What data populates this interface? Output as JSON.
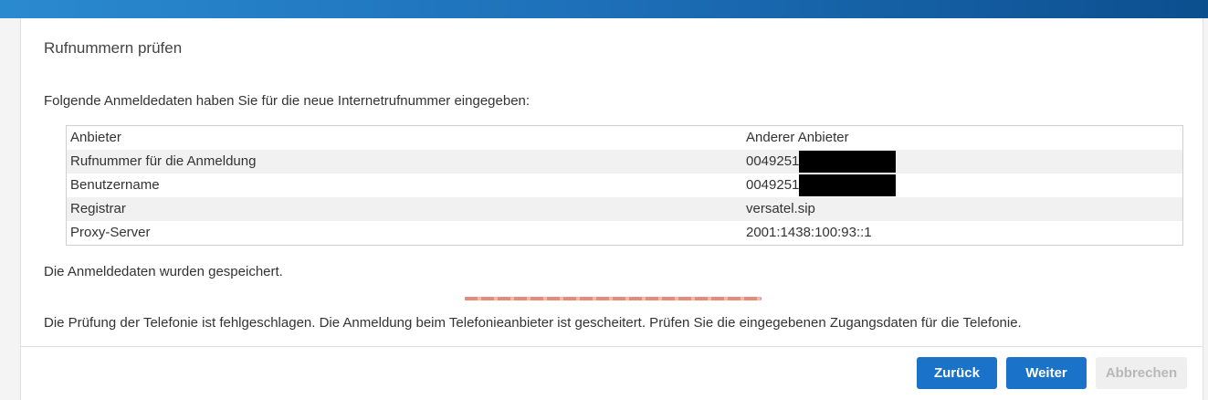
{
  "dialog": {
    "title": "Rufnummern prüfen",
    "intro": "Folgende Anmeldedaten haben Sie für die neue Internetrufnummer eingegeben:",
    "saved_message": "Die Anmeldedaten wurden gespeichert.",
    "error_message": "Die Prüfung der Telefonie ist fehlgeschlagen. Die Anmeldung beim Telefonieanbieter ist gescheitert. Prüfen Sie die eingegebenen Zugangsdaten für die Telefonie."
  },
  "table": {
    "rows": [
      {
        "label": "Anbieter",
        "value": "Anderer Anbieter"
      },
      {
        "label": "Rufnummer für die Anmeldung",
        "value": "0049251"
      },
      {
        "label": "Benutzername",
        "value": "0049251"
      },
      {
        "label": "Registrar",
        "value": "versatel.sip"
      },
      {
        "label": "Proxy-Server",
        "value": "2001:1438:100:93::1"
      }
    ]
  },
  "buttons": {
    "back": "Zurück",
    "next": "Weiter",
    "cancel": "Abbrechen"
  },
  "colors": {
    "primary": "#1a73c9",
    "topbar": "#1d6fb8",
    "progress": "#e68a7a"
  }
}
